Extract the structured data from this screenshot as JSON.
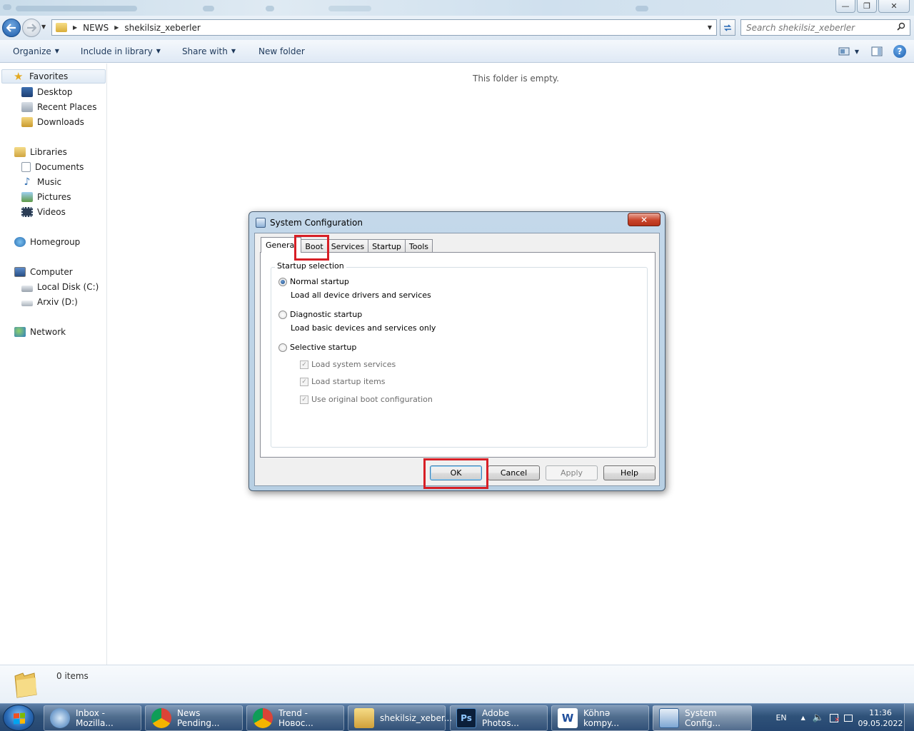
{
  "window": {
    "minimize_glyph": "—",
    "maximize_glyph": "❐",
    "close_glyph": "✕"
  },
  "address_bar": {
    "breadcrumb": [
      "NEWS",
      "shekilsiz_xeberler"
    ],
    "search_placeholder": "Search shekilsiz_xeberler"
  },
  "command_bar": {
    "items": [
      "Organize",
      "Include in library",
      "Share with",
      "New folder"
    ],
    "help_glyph": "?"
  },
  "nav_pane": {
    "favorites": "Favorites",
    "favorites_items": [
      "Desktop",
      "Recent Places",
      "Downloads"
    ],
    "libraries": "Libraries",
    "libraries_items": [
      "Documents",
      "Music",
      "Pictures",
      "Videos"
    ],
    "homegroup": "Homegroup",
    "computer": "Computer",
    "computer_items": [
      "Local Disk (C:)",
      "Arxiv (D:)"
    ],
    "network": "Network"
  },
  "content": {
    "empty_message": "This folder is empty."
  },
  "details": {
    "item_count": "0 items"
  },
  "dialog": {
    "title": "System Configuration",
    "close_glyph": "✕",
    "tabs": [
      "General",
      "Boot",
      "Services",
      "Startup",
      "Tools"
    ],
    "active_tab": "General",
    "group_label": "Startup selection",
    "options": {
      "normal": {
        "label": "Normal startup",
        "desc": "Load all device drivers and services",
        "selected": true
      },
      "diagnostic": {
        "label": "Diagnostic startup",
        "desc": "Load basic devices and services only",
        "selected": false
      },
      "selective": {
        "label": "Selective startup",
        "selected": false
      }
    },
    "checkboxes": [
      "Load system services",
      "Load startup items",
      "Use original boot configuration"
    ],
    "buttons": {
      "ok": "OK",
      "cancel": "Cancel",
      "apply": "Apply",
      "help": "Help"
    },
    "highlight_color": "#d71f26"
  },
  "taskbar": {
    "buttons": [
      {
        "label": "Inbox - Mozilla...",
        "icon": "thunderbird-icon"
      },
      {
        "label": "News Pending...",
        "icon": "chrome-icon"
      },
      {
        "label": "Trend - Новос...",
        "icon": "chrome-icon"
      },
      {
        "label": "shekilsiz_xeber...",
        "icon": "folder-icon"
      },
      {
        "label": "Adobe Photos...",
        "icon": "photoshop-icon",
        "glyph": "Ps"
      },
      {
        "label": "Köhnə kompy...",
        "icon": "word-icon",
        "glyph": "W"
      },
      {
        "label": "System Config...",
        "icon": "msconfig-icon"
      }
    ],
    "language": "EN",
    "time": "11:36",
    "date": "09.05.2022"
  }
}
